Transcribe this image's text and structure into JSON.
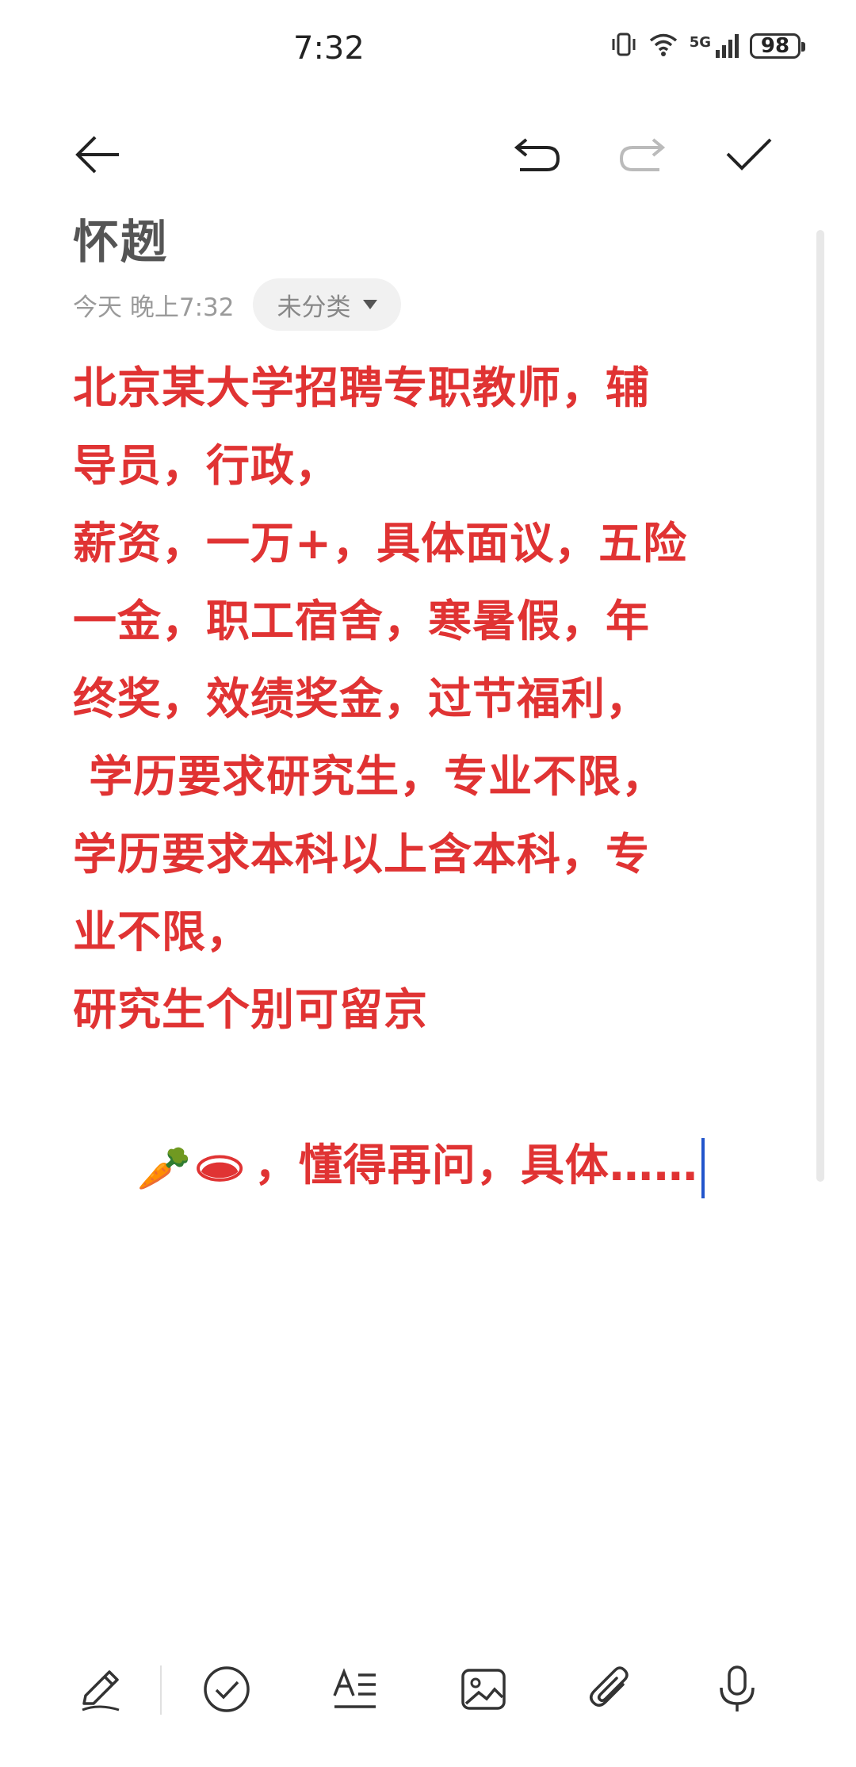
{
  "status_bar": {
    "time": "7:32",
    "network": "5G",
    "battery": "98",
    "icons": [
      "vibrate-icon",
      "wifi-icon",
      "signal-icon",
      "battery-icon"
    ]
  },
  "toolbar": {
    "icons": [
      "back-arrow-icon",
      "undo-icon",
      "redo-icon",
      "check-icon"
    ]
  },
  "note": {
    "title": "怀趔",
    "date": "今天 晚上7:32",
    "category": "未分类",
    "lines": [
      "北京某大学招聘专职教师，辅",
      "导员，行政，",
      "薪资，一万+，具体面议，五险",
      "一金，职工宿舍，寒暑假，年",
      "终奖，效绩奖金，过节福利，",
      " 学历要求研究生，专业不限，",
      "学历要求本科以上含本科，专",
      "业不限，",
      "研究生个别可留京"
    ],
    "last_line_emojis": "🥕🕳",
    "last_line_text": "，懂得再问，具体……"
  },
  "colors": {
    "body_text": "#e03333",
    "title": "#555555",
    "cursor": "#2255cc"
  },
  "bottom_toolbar": {
    "icons": [
      "pen-icon",
      "checklist-icon",
      "text-format-icon",
      "image-icon",
      "attachment-icon",
      "microphone-icon"
    ]
  }
}
